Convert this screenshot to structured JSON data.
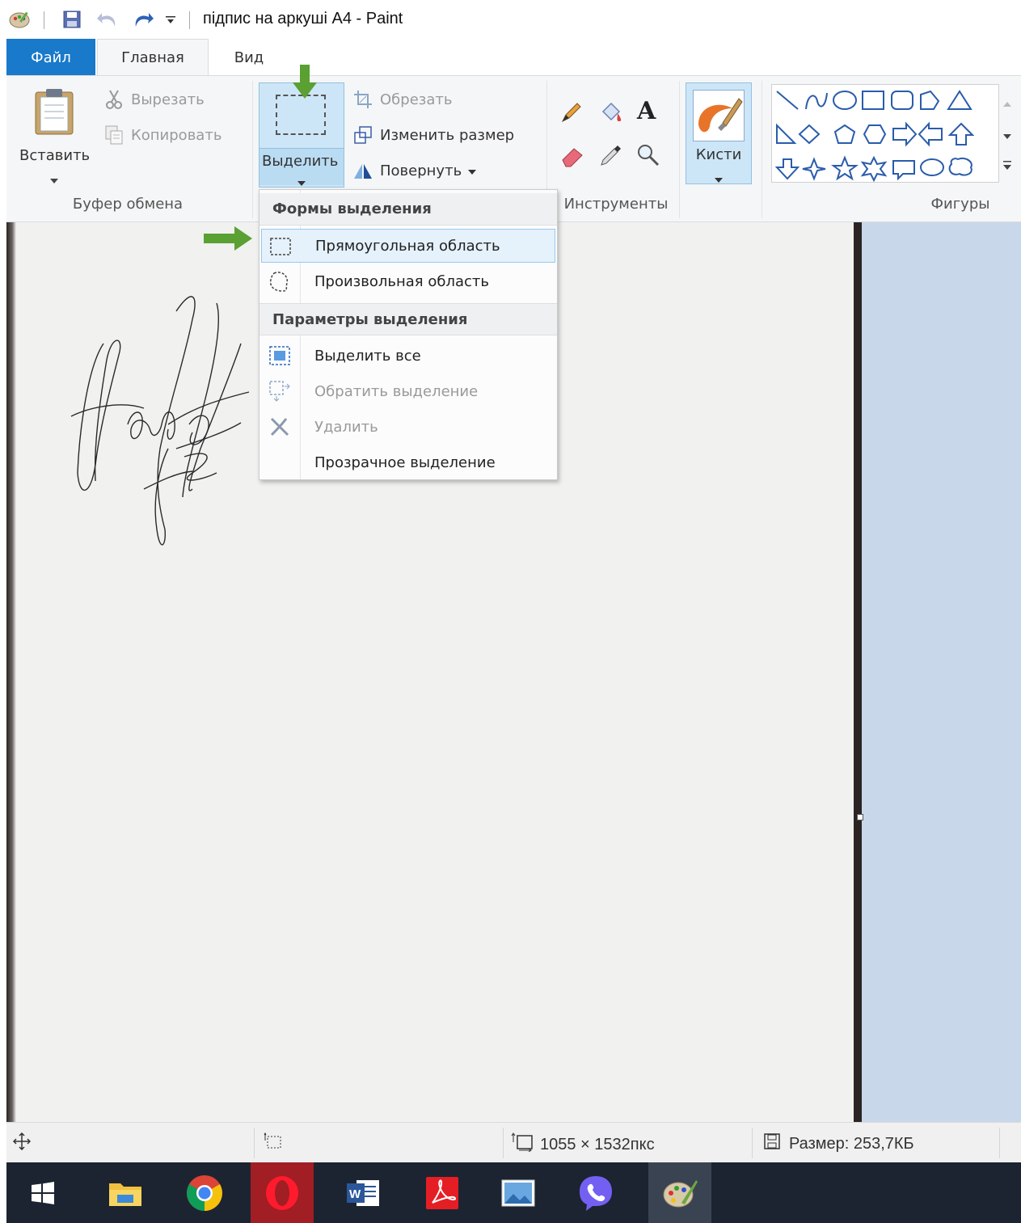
{
  "window": {
    "title": "підпис на аркуші A4 - Paint"
  },
  "tabs": [
    {
      "label": "Файл"
    },
    {
      "label": "Главная"
    },
    {
      "label": "Вид"
    }
  ],
  "ribbon": {
    "clipboard": {
      "paste_label": "Вставить",
      "cut_label": "Вырезать",
      "copy_label": "Копировать",
      "group_label": "Буфер обмена"
    },
    "image": {
      "select_label": "Выделить",
      "crop_label": "Обрезать",
      "resize_label": "Изменить размер",
      "rotate_label": "Повернуть"
    },
    "tools": {
      "group_label": "Инструменты"
    },
    "brushes": {
      "label": "Кисти"
    },
    "shapes": {
      "group_label": "Фигуры"
    }
  },
  "select_menu": {
    "shapes_header": "Формы выделения",
    "rect_label": "Прямоугольная область",
    "freeform_label": "Произвольная область",
    "options_header": "Параметры выделения",
    "select_all_label": "Выделить все",
    "invert_label": "Обратить выделение",
    "delete_label": "Удалить",
    "transparent_label": "Прозрачное выделение"
  },
  "statusbar": {
    "dimensions": "1055 × 1532пкс",
    "size": "Размер: 253,7КБ"
  },
  "colors": {
    "file_tab": "#1979ca",
    "ribbon_bg": "#f5f6f7",
    "highlight": "#e5f1fb",
    "arrow": "#5aa033",
    "taskbar": "#1c2431"
  },
  "taskbar_icons": [
    "start-icon",
    "file-explorer-icon",
    "chrome-icon",
    "opera-icon",
    "word-icon",
    "acrobat-icon",
    "photos-icon",
    "viber-icon",
    "paint-icon"
  ]
}
